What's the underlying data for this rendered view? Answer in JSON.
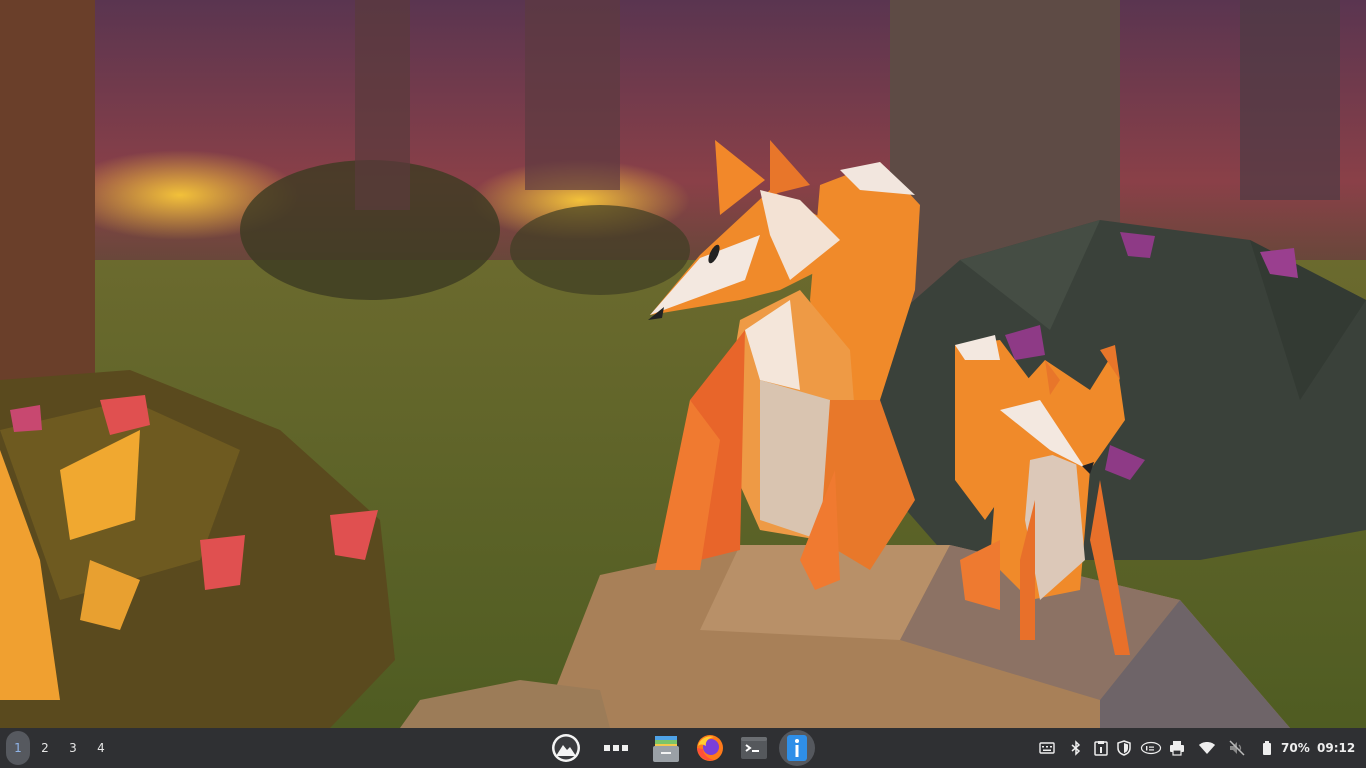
{
  "workspaces": [
    {
      "label": "1",
      "active": true
    },
    {
      "label": "2",
      "active": false
    },
    {
      "label": "3",
      "active": false
    },
    {
      "label": "4",
      "active": false
    }
  ],
  "dock": [
    {
      "name": "app-menu-icon"
    },
    {
      "name": "app-grid-icon"
    },
    {
      "name": "file-manager-icon"
    },
    {
      "name": "firefox-icon"
    },
    {
      "name": "terminal-icon"
    },
    {
      "name": "info-icon"
    }
  ],
  "tray": {
    "icons": [
      "keyboard-icon",
      "bluetooth-icon",
      "clipboard-icon",
      "shield-icon",
      "intel-icon",
      "printer-icon",
      "wifi-icon",
      "volume-muted-icon",
      "battery-icon"
    ],
    "battery_text": "70%",
    "clock": "09:12"
  },
  "colors": {
    "panel": "#2f3033",
    "accent": "#2f8fe8",
    "fox": "#f08a2a"
  }
}
